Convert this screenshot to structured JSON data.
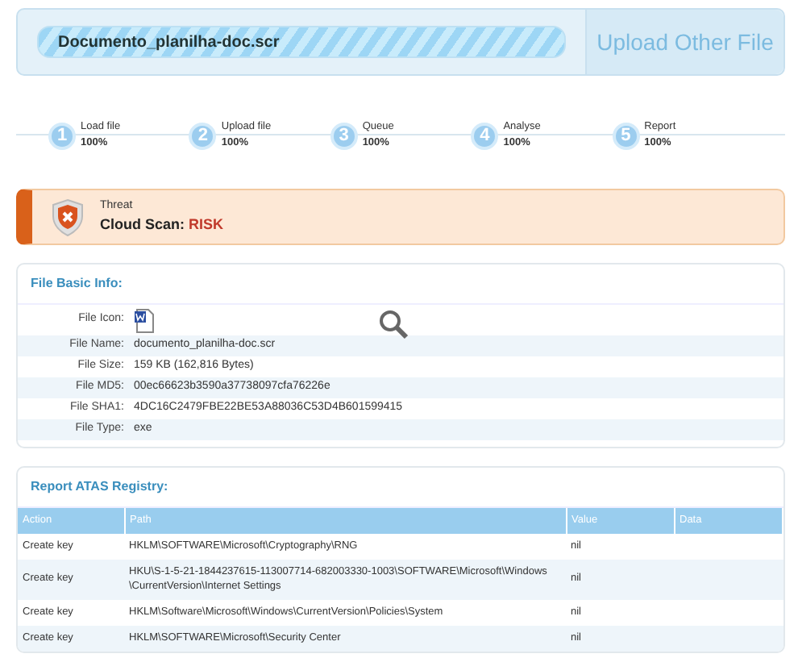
{
  "upload": {
    "file_name": "Documento_planilha-doc.scr",
    "button": "Upload Other File"
  },
  "steps": [
    {
      "number": "1",
      "label": "Load file",
      "progress": "100%",
      "completed": true
    },
    {
      "number": "2",
      "label": "Upload file",
      "progress": "100%",
      "completed": true
    },
    {
      "number": "3",
      "label": "Queue",
      "progress": "100%",
      "completed": true
    },
    {
      "number": "4",
      "label": "Analyse",
      "progress": "100%",
      "completed": true
    },
    {
      "number": "5",
      "label": "Report",
      "progress": "100%",
      "completed": true
    }
  ],
  "threat": {
    "label": "Threat",
    "scan": "Cloud Scan: ",
    "result": "RISK"
  },
  "file_info": {
    "title": "File Basic Info:",
    "icon_label": "File Icon:",
    "rows": [
      {
        "label": "File Name:",
        "value": "documento_planilha-doc.scr"
      },
      {
        "label": "File Size:",
        "value": "159 KB (162,816 Bytes)"
      },
      {
        "label": "File MD5:",
        "value": "00ec66623b3590a37738097cfa76226e"
      },
      {
        "label": "File SHA1:",
        "value": "4DC16C2479FBE22BE53A88036C53D4B601599415"
      },
      {
        "label": "File Type:",
        "value": "exe"
      }
    ]
  },
  "registry": {
    "title": "Report ATAS Registry:",
    "columns": [
      "Action",
      "Path",
      "Value",
      "Data"
    ],
    "rows": [
      [
        "Create key",
        "HKLM\\SOFTWARE\\Microsoft\\Cryptography\\RNG",
        "nil"
      ],
      [
        "Create key",
        "HKU\\S-1-5-21-1844237615-113007714-682003330-1003\\SOFTWARE\\Microsoft\\Windows \\CurrentVersion\\Internet Settings",
        "nil"
      ],
      [
        "Create key",
        "HKLM\\Software\\Microsoft\\Windows\\CurrentVersion\\Policies\\System",
        "nil"
      ],
      [
        "Create key",
        "HKLM\\SOFTWARE\\Microsoft\\Security Center",
        "nil"
      ]
    ]
  }
}
